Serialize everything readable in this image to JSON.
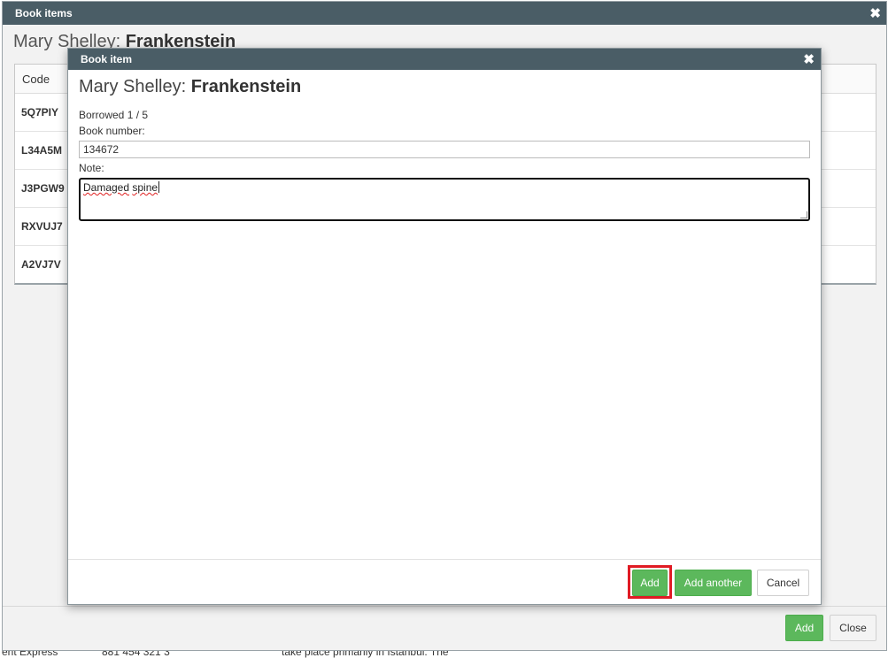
{
  "background": {
    "row_fragments": [
      "ent Express",
      "881 454 321 3",
      "take place primarily in Istanbul. The"
    ]
  },
  "outer_dialog": {
    "title": "Book items",
    "close_glyph": "✖",
    "author": "Mary Shelley: ",
    "book_title": "Frankenstein",
    "table": {
      "header_code": "Code",
      "rows": [
        "5Q7PIY",
        "L34A5M",
        "J3PGW9",
        "RXVUJ7",
        "A2VJ7V"
      ]
    },
    "add_label": "Add",
    "close_label": "Close"
  },
  "inner_dialog": {
    "title": "Book item",
    "close_glyph": "✖",
    "author": "Mary Shelley: ",
    "book_title": "Frankenstein",
    "borrowed_text": "Borrowed 1 / 5",
    "book_number_label": "Book number:",
    "book_number_value": "134672",
    "note_label": "Note:",
    "note_word1": "Damaged",
    "note_word2": "spine",
    "add_label": "Add",
    "add_another_label": "Add another",
    "cancel_label": "Cancel"
  },
  "colors": {
    "titlebar": "#4a5d66",
    "primary_green": "#5cb85c",
    "highlight_red": "#e01b24"
  }
}
